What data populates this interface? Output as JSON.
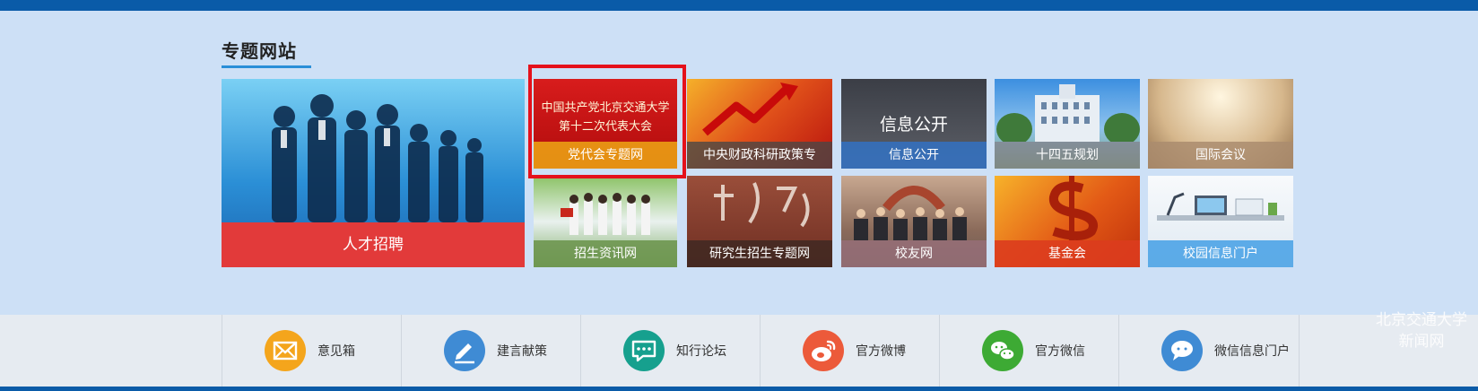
{
  "section": {
    "title": "专题网站"
  },
  "tiles": {
    "big": {
      "label": "人才招聘"
    },
    "t1": {
      "label": "党代会专题网",
      "banner_line1": "中国共产党北京交通大学",
      "banner_line2": "第十二次代表大会"
    },
    "t2": {
      "label": "中央财政科研政策专"
    },
    "t3": {
      "label": "信息公开",
      "overlay": "信息公开"
    },
    "t4": {
      "label": "十四五规划"
    },
    "t5": {
      "label": "国际会议"
    },
    "t6": {
      "label": "招生资讯网"
    },
    "t7": {
      "label": "研究生招生专题网"
    },
    "t8": {
      "label": "校友网"
    },
    "t9": {
      "label": "基金会"
    },
    "t10": {
      "label": "校园信息门户"
    }
  },
  "footer": {
    "items": [
      {
        "label": "意见箱",
        "icon": "mail-icon",
        "color": "#f4a51c"
      },
      {
        "label": "建言献策",
        "icon": "pen-icon",
        "color": "#3f8bd4"
      },
      {
        "label": "知行论坛",
        "icon": "chat-icon",
        "color": "#16a08e"
      },
      {
        "label": "官方微博",
        "icon": "weibo-icon",
        "color": "#ec5a3a"
      },
      {
        "label": "官方微信",
        "icon": "wechat-icon",
        "color": "#3daa34"
      },
      {
        "label": "微信信息门户",
        "icon": "message-icon",
        "color": "#3f8bd4"
      }
    ]
  },
  "watermark": {
    "line1": "北京交通大学",
    "line2": "新闻网"
  },
  "colors": {
    "topbar": "#0a5ba8",
    "section_bg": "#cde0f6",
    "highlight": "#e5111b",
    "accent_underline": "#2a8fd8"
  }
}
